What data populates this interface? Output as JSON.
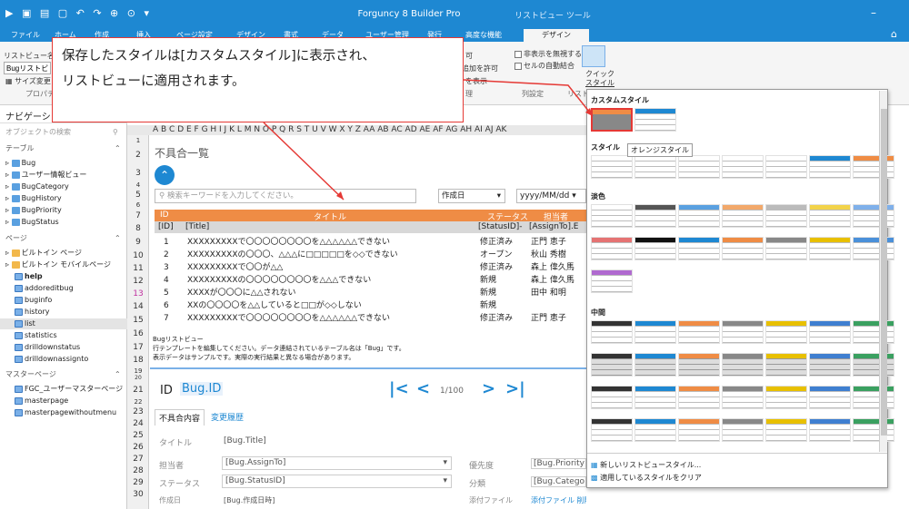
{
  "titlebar": {
    "title": "Forguncy 8 Builder Pro",
    "context_tab": "リストビュー ツール",
    "minimize": "–"
  },
  "tabs": [
    {
      "label": "ファイル"
    },
    {
      "label": "ホーム"
    },
    {
      "label": "作成"
    },
    {
      "label": "挿入"
    },
    {
      "label": "ページ設定"
    },
    {
      "label": "デザイン"
    },
    {
      "label": "書式"
    },
    {
      "label": "データ"
    },
    {
      "label": "ユーザー管理"
    },
    {
      "label": "発行"
    },
    {
      "label": "高度な機能"
    },
    {
      "label": "デザイン"
    }
  ],
  "ribbon": {
    "listview_name_label": "リストビュー名",
    "listview_name_value": "Bugリストビュー",
    "size_change": "サイズ変更",
    "property": "プロパティ",
    "allow_hidden": "非表示を無視する",
    "auto_merge": "セルの自動結合",
    "allow": "可",
    "add_allow": "追加を許可",
    "show": "を表示",
    "manage": "理",
    "col_setting": "列設定",
    "quick_style_line1": "クイック",
    "quick_style_line2": "スタイル",
    "list_label": "リスト"
  },
  "callout": {
    "line1": "保存したスタイルは[カスタムスタイル]に表示され、",
    "line2": "リストビューに適用されます。"
  },
  "nav": {
    "title": "ナビゲーション",
    "search_placeholder": "オブジェクトの検索",
    "tables_label": "テーブル",
    "tables": [
      "Bug",
      "ユーザー情報ビュー",
      "BugCategory",
      "BugHistory",
      "BugPriority",
      "BugStatus"
    ],
    "pages_label": "ページ",
    "builtin_pages": "ビルトイン ページ",
    "builtin_mobile": "ビルトイン モバイルページ",
    "pages": [
      "help",
      "addoreditbug",
      "buginfo",
      "history",
      "list",
      "statistics",
      "drilldownstatus",
      "drilldownassignto"
    ],
    "master_label": "マスターページ",
    "masters": [
      "FGC_ユーザーマスターページ",
      "masterpage",
      "masterpagewithoutmenu"
    ]
  },
  "grid": {
    "columns": "A B C D E F G H I J K L M N O P Q R S T U V W X Y Z AA AB AC AD AE AF AG AH AI AJ AK",
    "rows": [
      "1",
      "2",
      "3",
      "4",
      "5",
      "6",
      "7",
      "8",
      "9",
      "10",
      "11",
      "12",
      "13",
      "14",
      "15",
      "16",
      "17",
      "18",
      "19",
      "20",
      "21",
      "22",
      "23",
      "24",
      "25",
      "26",
      "27",
      "28",
      "29",
      "30"
    ],
    "page_title": "不具合一覧",
    "search_placeholder": "検索キーワードを入力してください。",
    "date_label": "作成日",
    "date_placeholder": "yyyy/MM/dd",
    "header": {
      "id": "ID",
      "title": "タイトル",
      "status": "ステータス",
      "assignee": "担当者"
    },
    "header2": {
      "id": "[ID]",
      "title": "[Title]",
      "status": "[StatusID]-",
      "assignee": "[AssignTo].E"
    },
    "rows_data": [
      {
        "no": "1",
        "title": "XXXXXXXXXで〇〇〇〇〇〇〇〇を△△△△△△できない",
        "status": "修正済み",
        "person": "正門 恵子"
      },
      {
        "no": "2",
        "title": "XXXXXXXXXの〇〇〇、△△△に□□□□□を◇◇できない",
        "status": "オープン",
        "person": "秋山 秀樹"
      },
      {
        "no": "3",
        "title": "XXXXXXXXXで〇〇が△△",
        "status": "修正済み",
        "person": "森上 偉久馬"
      },
      {
        "no": "4",
        "title": "XXXXXXXXXの〇〇〇〇〇〇〇〇を△△△できない",
        "status": "新規",
        "person": "森上 偉久馬"
      },
      {
        "no": "5",
        "title": "XXXXが〇〇〇に△△されない",
        "status": "新規",
        "person": "田中 和明"
      },
      {
        "no": "6",
        "title": "XXの〇〇〇〇を△△していると□□が◇◇しない",
        "status": "新規",
        "person": ""
      },
      {
        "no": "7",
        "title": "XXXXXXXXXで〇〇〇〇〇〇〇〇を△△△△△△できない",
        "status": "修正済み",
        "person": "正門 恵子"
      }
    ],
    "note1": "Bugリストビュー",
    "note2": "行テンプレートを編集してください。データ連結されているテーブル名は「Bug」です。",
    "note3": "表示データはサンプルです。実際の実行結果と異なる場合があります。",
    "detail_id_label": "ID",
    "detail_id_value": "Bug.ID",
    "pager": "1/100",
    "tab_detail": "不具合内容",
    "tab_history": "変更履歴",
    "f_title": "タイトル",
    "f_title_v": "[Bug.Title]",
    "f_assignee": "担当者",
    "f_assignee_v": "[Bug.AssignTo]",
    "f_priority": "優先度",
    "f_priority_v": "[Bug.Priority",
    "f_status": "ステータス",
    "f_status_v": "[Bug.StatusID]",
    "f_category": "分類",
    "f_category_v": "[Bug.Catego",
    "f_created": "作成日",
    "f_created_v": "[Bug.作成日時]",
    "f_attach": "添付ファイル",
    "f_attach_v": "添付ファイル 削除"
  },
  "panel": {
    "custom": "カスタムスタイル",
    "style": "スタイル",
    "tooltip": "オレンジスタイル",
    "light": "淡色",
    "medium": "中間",
    "new_style": "新しいリストビュースタイル...",
    "clear_style": "適用しているスタイルをクリア"
  },
  "colors": {
    "accent": "#1e88d2",
    "orange": "#ef8c45",
    "red": "#e53935"
  }
}
